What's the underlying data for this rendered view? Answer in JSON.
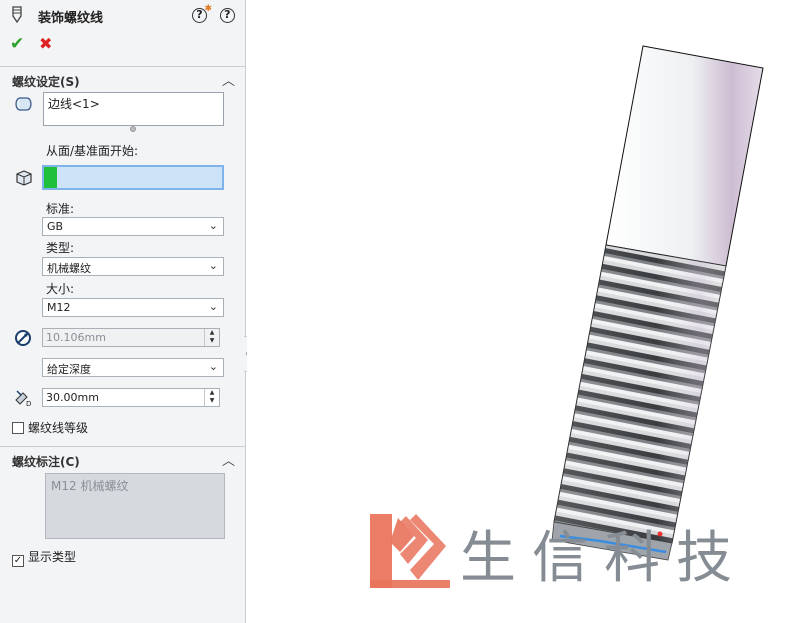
{
  "panel": {
    "title": "装饰螺纹线",
    "help_icon": "help-icon",
    "whats_new_icon": "whats-new-icon",
    "ok_icon": "checkmark-icon",
    "cancel_icon": "close-icon"
  },
  "thread_settings": {
    "header": "螺纹设定(S)",
    "edge_value": "边线<1>",
    "start_from_label": "从面/基准面开始:",
    "start_from_value": "",
    "standard_label": "标准:",
    "standard_value": "GB",
    "type_label": "类型:",
    "type_value": "机械螺纹",
    "size_label": "大小:",
    "size_value": "M12",
    "diameter_value": "10.106mm",
    "end_condition_value": "给定深度",
    "depth_value": "30.00mm",
    "thread_class_label": "螺纹线等级",
    "thread_class_checked": false
  },
  "thread_callout": {
    "header": "螺纹标注(C)",
    "callout_text": "M12 机械螺纹",
    "show_type_label": "显示类型",
    "show_type_checked": true
  },
  "watermark": {
    "text": "生信科技"
  },
  "colors": {
    "accent_green": "#1fc03b",
    "selection_blue": "#cde3f8",
    "ok_green": "#2ea02e",
    "cancel_red": "#d22222",
    "logo_red": "#e9725a"
  }
}
